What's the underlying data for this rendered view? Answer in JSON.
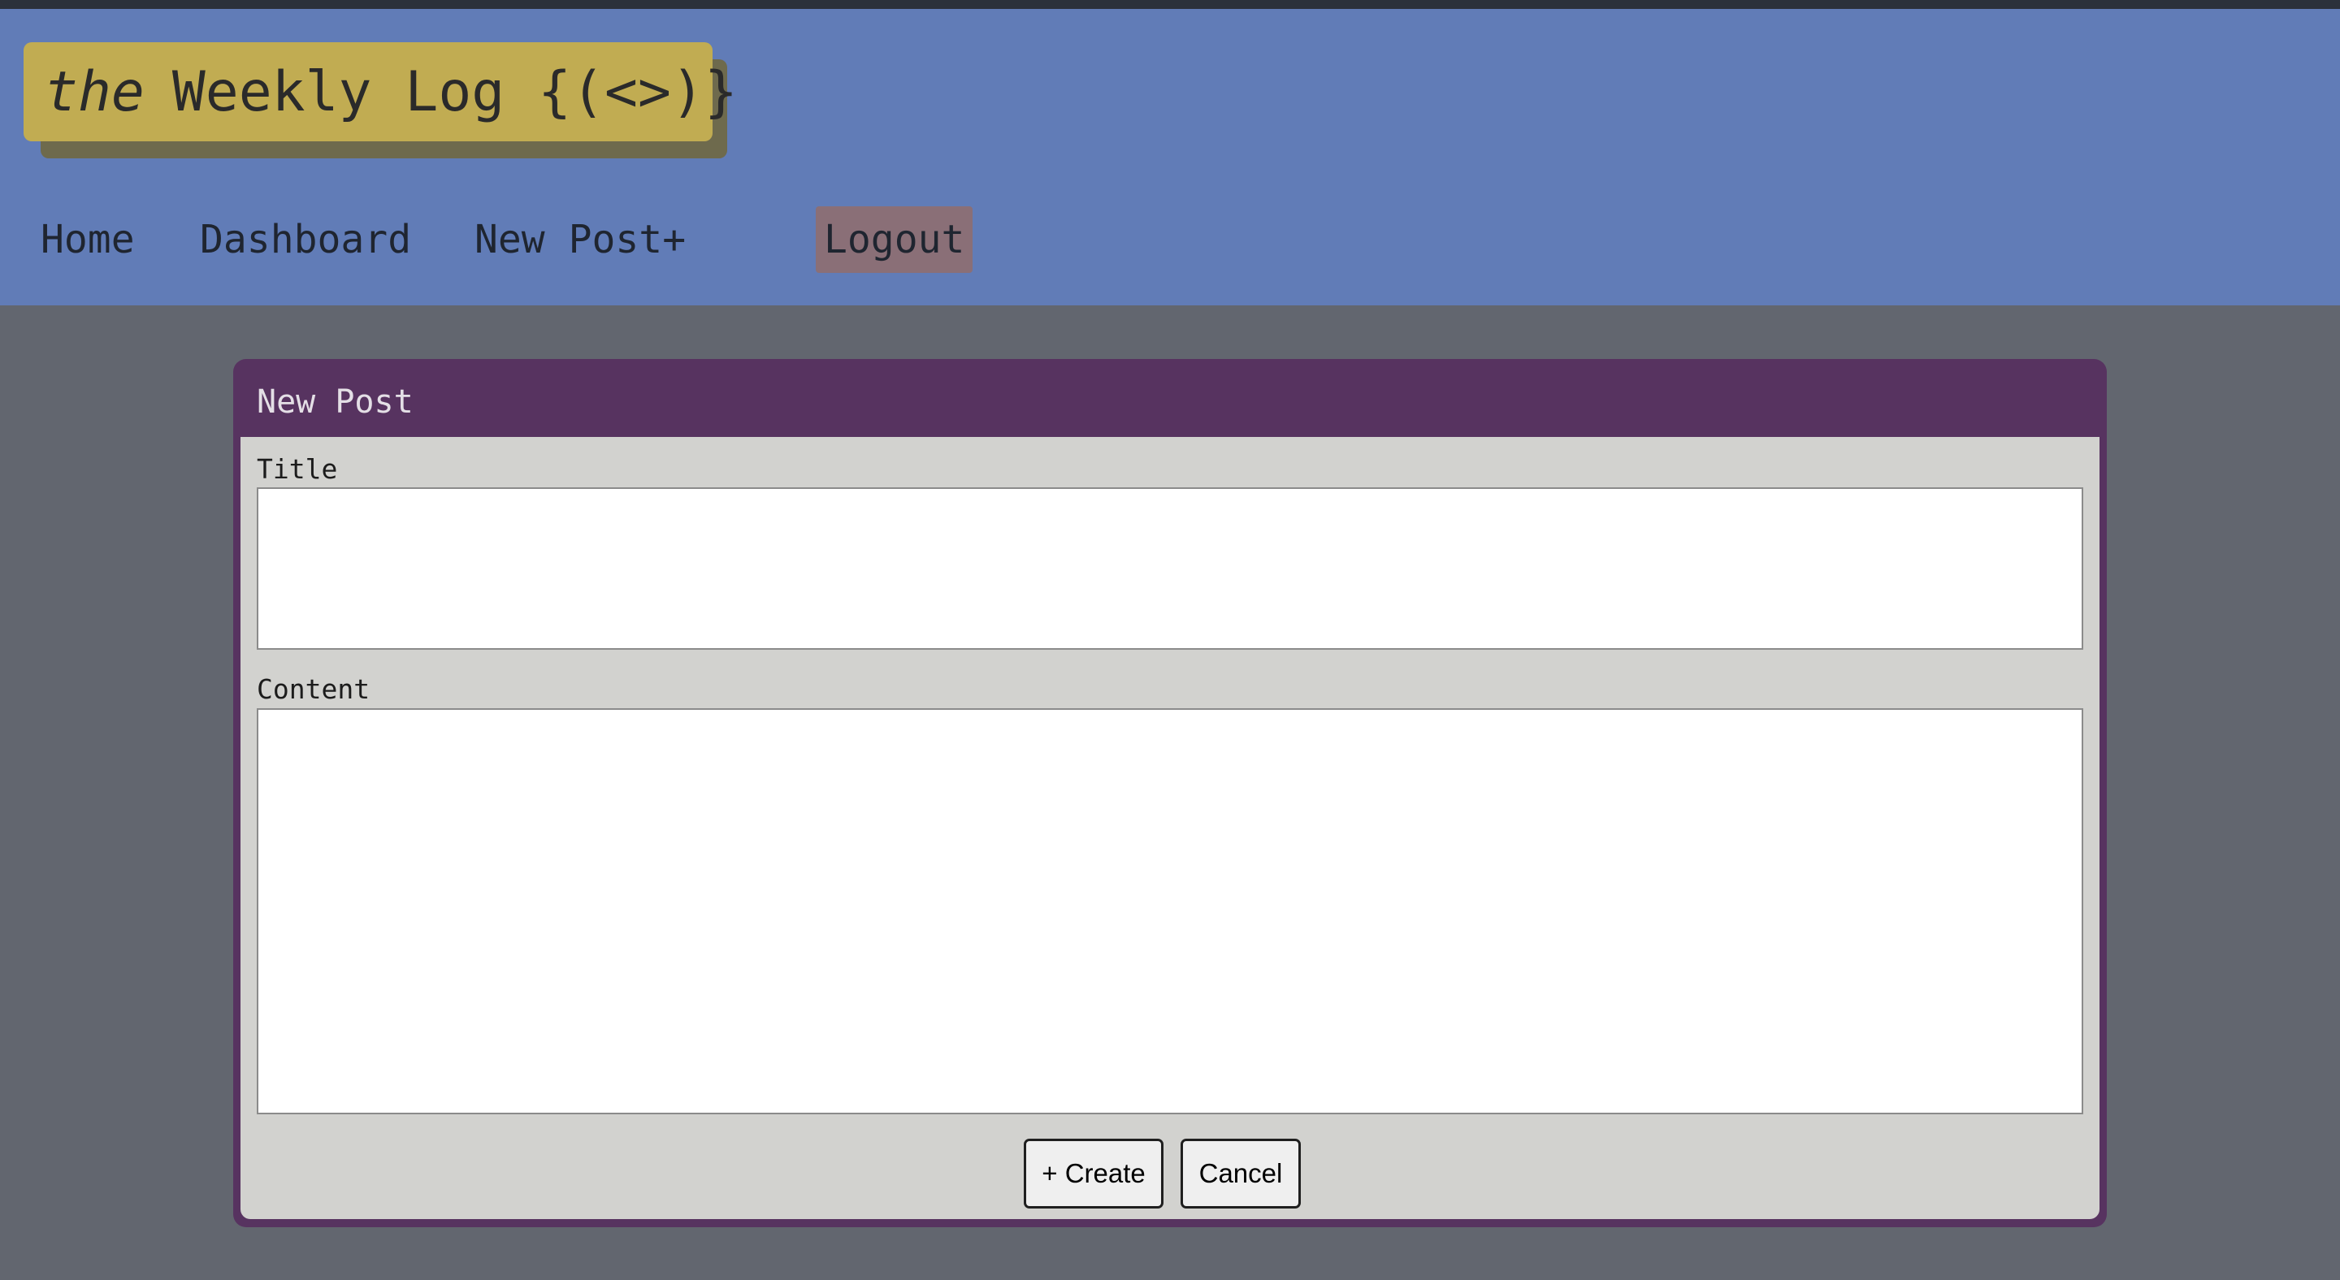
{
  "header": {
    "logo": {
      "prefix": "the",
      "name": "Weekly Log {(<>)}"
    },
    "nav": {
      "home": "Home",
      "dashboard": "Dashboard",
      "new_post": "New Post+",
      "logout": "Logout"
    }
  },
  "form": {
    "heading": "New Post",
    "title_label": "Title",
    "title_value": "",
    "content_label": "Content",
    "content_value": "",
    "create_label": "+ Create",
    "cancel_label": "Cancel"
  },
  "colors": {
    "page_background": "#62666f",
    "header_background": "#617cb7",
    "logo_background": "#c1ac52",
    "logout_background": "#8a6f77",
    "card_border": "#573360",
    "card_body": "#d2d2cf"
  }
}
